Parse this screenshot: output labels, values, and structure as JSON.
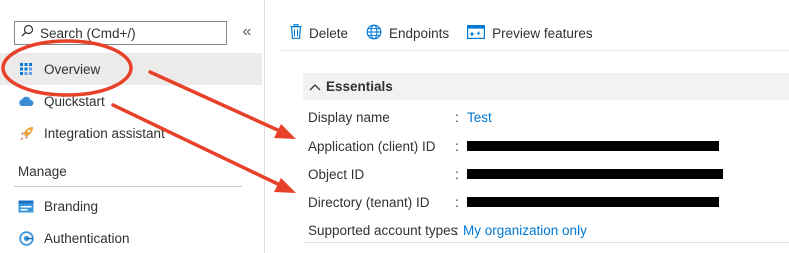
{
  "sidebar": {
    "search_placeholder": "Search (Cmd+/)",
    "collapse_glyph": "«",
    "items": [
      {
        "label": "Overview",
        "icon": "grid-icon"
      },
      {
        "label": "Quickstart",
        "icon": "cloud-icon"
      },
      {
        "label": "Integration assistant",
        "icon": "rocket-icon"
      }
    ],
    "manage_section": "Manage",
    "manage_items": [
      {
        "label": "Branding",
        "icon": "branding-icon"
      },
      {
        "label": "Authentication",
        "icon": "authentication-icon"
      }
    ]
  },
  "toolbar": {
    "delete_label": "Delete",
    "endpoints_label": "Endpoints",
    "preview_label": "Preview features"
  },
  "essentials": {
    "title": "Essentials",
    "rows": [
      {
        "label": "Display name",
        "value": "Test"
      },
      {
        "label": "Application (client) ID",
        "value": ""
      },
      {
        "label": "Object ID",
        "value": ""
      },
      {
        "label": "Directory (tenant) ID",
        "value": ""
      },
      {
        "label": "Supported account types",
        "value": "My organization only"
      }
    ]
  },
  "colors": {
    "accent": "#0078d4",
    "annotation": "#e8412a",
    "selected_bg": "#edebe9"
  }
}
